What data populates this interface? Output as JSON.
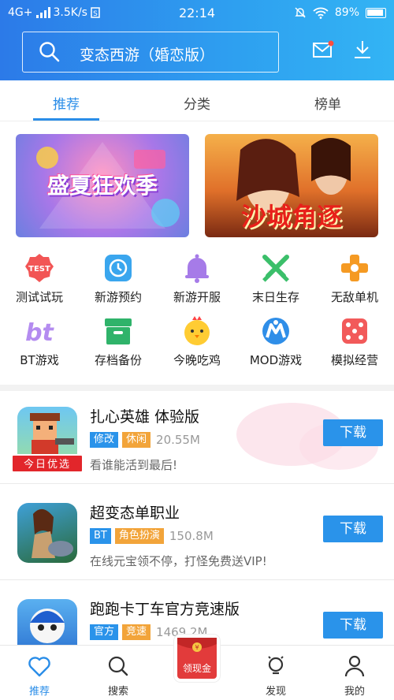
{
  "status_bar": {
    "network": "4G+",
    "speed": "3.5K/s",
    "time": "22:14",
    "battery": "89%"
  },
  "header": {
    "search_text": "变态西游（婚恋版）",
    "icons": [
      "search-icon",
      "mail-icon",
      "download-icon"
    ],
    "accent": "#2a8de8"
  },
  "tabs": [
    {
      "label": "推荐",
      "active": true
    },
    {
      "label": "分类",
      "active": false
    },
    {
      "label": "榜单",
      "active": false
    }
  ],
  "banners": [
    {
      "text": "盛夏狂欢季"
    },
    {
      "text": "沙城角逐"
    }
  ],
  "categories": [
    {
      "label": "测试试玩",
      "icon": "test-badge-icon",
      "badge": "TEST"
    },
    {
      "label": "新游预约",
      "icon": "clock-icon"
    },
    {
      "label": "新游开服",
      "icon": "bell-icon"
    },
    {
      "label": "末日生存",
      "icon": "crossed-swords-icon"
    },
    {
      "label": "无敌单机",
      "icon": "gamepad-icon"
    },
    {
      "label": "BT游戏",
      "icon": "bt-icon",
      "badge": "bt"
    },
    {
      "label": "存档备份",
      "icon": "archive-box-icon"
    },
    {
      "label": "今晚吃鸡",
      "icon": "chick-icon"
    },
    {
      "label": "MOD游戏",
      "icon": "mod-icon"
    },
    {
      "label": "模拟经营",
      "icon": "dice-icon"
    }
  ],
  "games": [
    {
      "title": "扎心英雄 体验版",
      "tags": [
        {
          "text": "修改",
          "color": "#2a93ea"
        },
        {
          "text": "休闲",
          "color": "#f2a43a"
        }
      ],
      "size": "20.55M",
      "desc": "看谁能活到最后!",
      "ribbon": "今日优选",
      "button": "下载"
    },
    {
      "title": "超变态单职业",
      "tags": [
        {
          "text": "BT",
          "color": "#2a93ea"
        },
        {
          "text": "角色扮演",
          "color": "#f2a43a"
        }
      ],
      "size": "150.8M",
      "desc": "在线元宝领不停，打怪免费送VIP!",
      "button": "下载"
    },
    {
      "title": "跑跑卡丁车官方竞速版",
      "tags": [
        {
          "text": "官方",
          "color": "#2a93ea"
        },
        {
          "text": "竞速",
          "color": "#f2a43a"
        }
      ],
      "size": "1469.2M",
      "button": "下载"
    }
  ],
  "bottom_nav": [
    {
      "label": "推荐",
      "icon": "heart-icon",
      "active": true
    },
    {
      "label": "搜索",
      "icon": "search-icon"
    },
    {
      "label": "领现金",
      "icon": "red-packet-icon"
    },
    {
      "label": "发现",
      "icon": "lightbulb-icon"
    },
    {
      "label": "我的",
      "icon": "user-icon"
    }
  ]
}
